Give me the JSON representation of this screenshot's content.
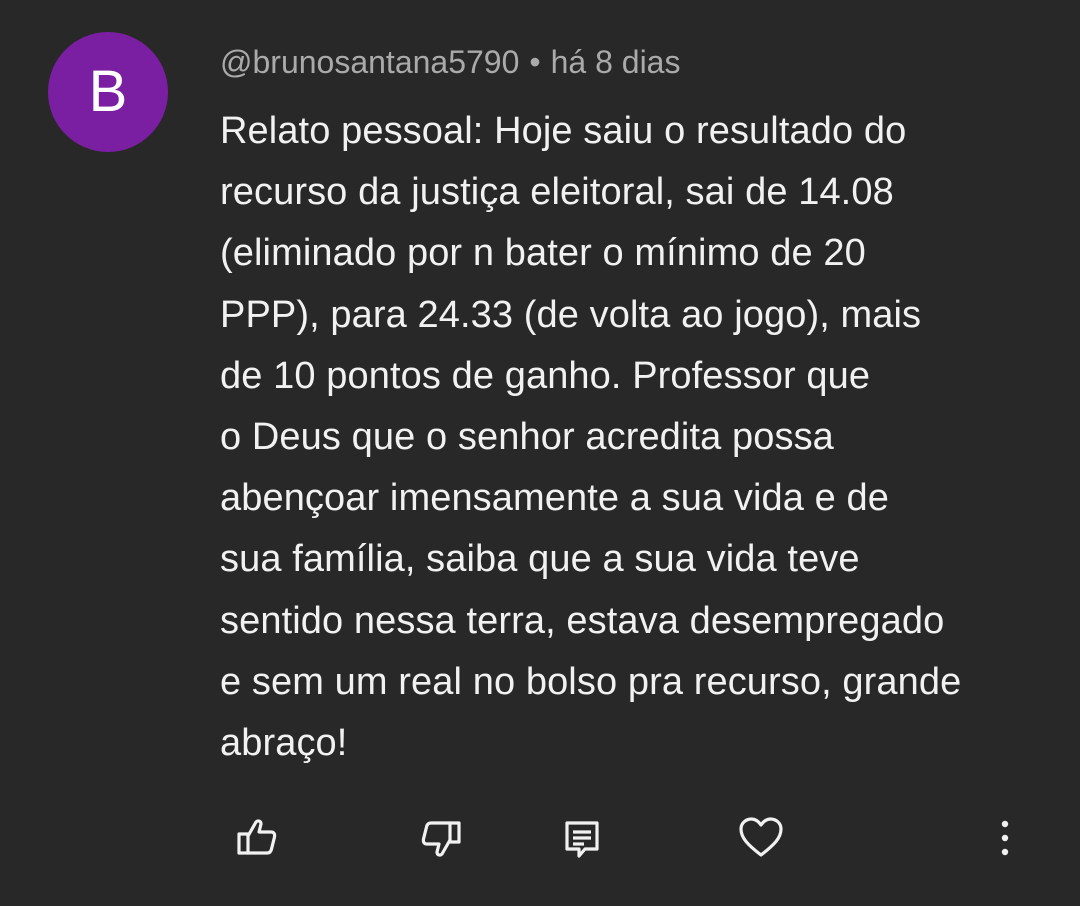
{
  "comment": {
    "avatar_letter": "B",
    "avatar_color": "#7b1fa2",
    "author": "@brunosantana5790",
    "separator": "•",
    "time": "há 8 dias",
    "text": "Relato pessoal: Hoje saiu o resultado do\nrecurso da justiça eleitoral, sai de 14.08\n(eliminado por n bater o mínimo de 20\nPPP), para 24.33 (de volta ao jogo), mais\nde 10 pontos de ganho. Professor que\no Deus que o senhor acredita possa\nabençoar imensamente a sua vida e de\nsua família, saiba que a sua vida teve\nsentido nessa terra, estava desempregado\ne sem um real no bolso pra recurso, grande\nabraço!"
  },
  "actions": {
    "like_icon": "thumbs-up-icon",
    "dislike_icon": "thumbs-down-icon",
    "reply_icon": "reply-comment-icon",
    "heart_icon": "heart-icon",
    "more_icon": "more-vertical-icon"
  },
  "colors": {
    "background": "#282828",
    "text_primary": "#f1f1f1",
    "text_secondary": "#aaaaaa",
    "icon": "#f1f1f1"
  }
}
